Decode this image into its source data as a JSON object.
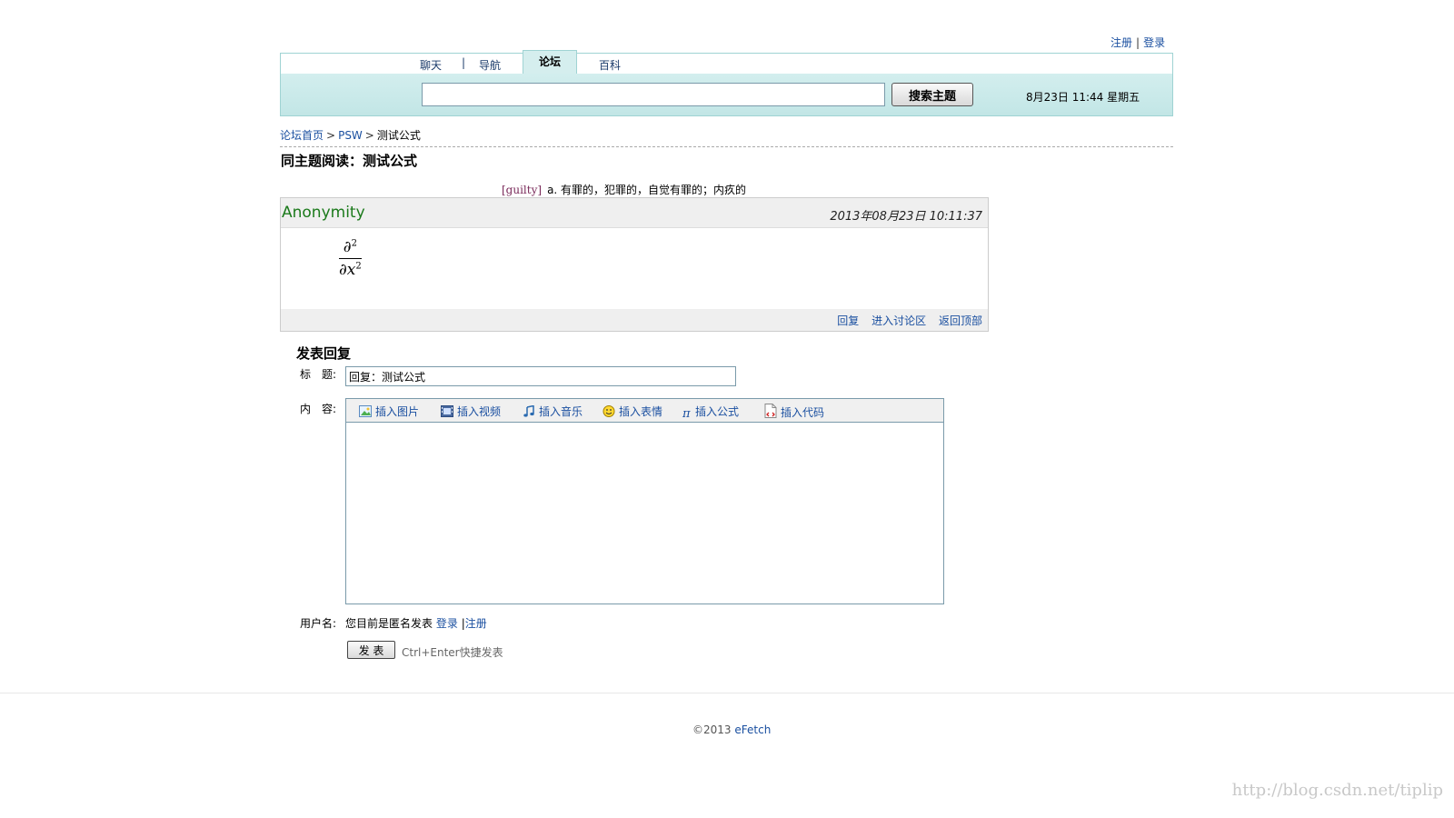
{
  "top_links": {
    "register": "注册",
    "separator": "|",
    "login": "登录"
  },
  "nav": {
    "tabs": [
      {
        "label": "聊天"
      },
      {
        "label": "导航"
      },
      {
        "label": "论坛"
      },
      {
        "label": "百科"
      }
    ],
    "separator": "|",
    "active_tab": "论坛"
  },
  "search": {
    "value": "",
    "button_label": "搜索主题"
  },
  "datetime": "8月23日 11:44 星期五",
  "breadcrumb": {
    "items": [
      "论坛首页",
      "PSW",
      "测试公式"
    ],
    "separator": ">"
  },
  "thread_title": "同主题阅读：测试公式",
  "definition": {
    "word": "[guilty]",
    "meaning": "a. 有罪的，犯罪的，自觉有罪的；内疚的"
  },
  "post": {
    "author": "Anonymity",
    "timestamp": "2013年08月23日 10:11:37",
    "formula": {
      "numerator": "∂",
      "numerator_exp": "2",
      "denominator": "∂x",
      "denominator_exp": "2"
    },
    "actions": {
      "reply": "回复",
      "enter_discussion": "进入讨论区",
      "back_to_top": "返回顶部"
    }
  },
  "reply_form": {
    "heading": "发表回复",
    "title_label": "标　题:",
    "title_value": "回复：测试公式",
    "content_label": "内　容:",
    "toolbar": [
      {
        "label": "插入图片",
        "icon": "image-icon"
      },
      {
        "label": "插入视频",
        "icon": "video-icon"
      },
      {
        "label": "插入音乐",
        "icon": "music-icon"
      },
      {
        "label": "插入表情",
        "icon": "smiley-icon"
      },
      {
        "label": "插入公式",
        "icon": "pi-icon"
      },
      {
        "label": "插入代码",
        "icon": "code-icon"
      }
    ],
    "content_value": "",
    "username_label": "用户名:",
    "anonymous_text": "您目前是匿名发表",
    "login_link": "登录",
    "separator": "|",
    "register_link": "注册",
    "submit_label": "发 表",
    "shortcut_hint": "Ctrl+Enter快捷发表"
  },
  "footer": {
    "copyright": "©2013",
    "brand": "eFetch"
  },
  "watermark": "http://blog.csdn.net/tiplip",
  "colors": {
    "header_bg": "#c8e8e8",
    "header_border": "#9fd3d3",
    "link": "#1a4fa0",
    "author": "#1b7a1b",
    "definition_word": "#7a2a5a"
  }
}
